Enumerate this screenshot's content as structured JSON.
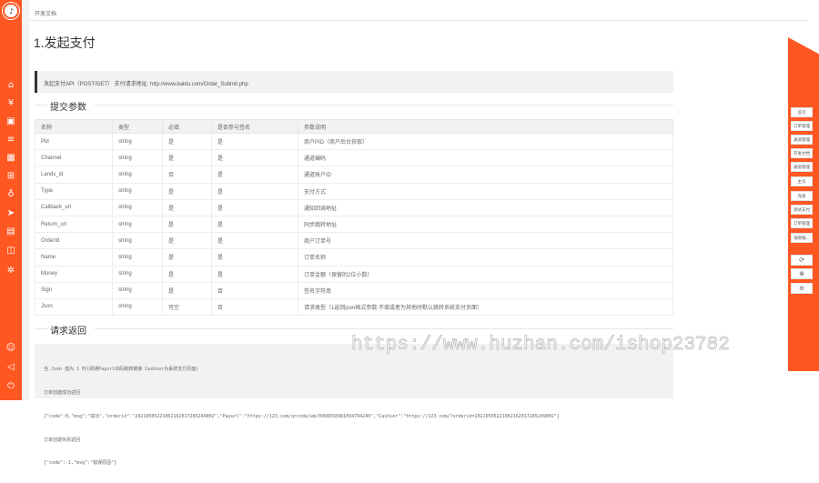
{
  "breadcrumb": "开发文档",
  "page_title": "1.发起支付",
  "api_info": "发起支付API（POST/GET）    支付请求地址:   http://www.baidu.com/Order_Submit.php",
  "section_params": "提交参数",
  "section_return": "请求返回",
  "table": {
    "headers": [
      "名称",
      "类型",
      "必填",
      "是否参与签名",
      "参数说明"
    ],
    "rows": [
      [
        "Pid",
        "string",
        "是",
        "是",
        "商户PID（商户后台获取）"
      ],
      [
        "Channel",
        "string",
        "是",
        "是",
        "通道编码"
      ],
      [
        "Lands_id",
        "string",
        "否",
        "是",
        "通道账户ID"
      ],
      [
        "Type",
        "string",
        "是",
        "是",
        "支付方式"
      ],
      [
        "Callback_url",
        "string",
        "是",
        "是",
        "通知回调地址"
      ],
      [
        "Return_url",
        "string",
        "是",
        "是",
        "同步跳转地址"
      ],
      [
        "OrderId",
        "string",
        "是",
        "是",
        "商户订单号"
      ],
      [
        "Name",
        "string",
        "是",
        "是",
        "订单名称"
      ],
      [
        "Money",
        "string",
        "是",
        "是",
        "订单金额（保留的2位小数）"
      ],
      [
        "Sign",
        "string",
        "是",
        "否",
        "签名字符串"
      ],
      [
        "Json",
        "string",
        "可空",
        "否",
        "请求类型（1返回json格式参数 不填或者为其他时默认跳转系统支付页面）"
      ]
    ]
  },
  "code_lines": [
    "当 Json 值为 1 时(即通Payurl出码跳转链接 Cashier为系统支付页面)",
    "订单创建成功返回",
    "{\"code\":0,\"msg\":\"成功\",\"orderid\":\"20210505221062162017285249002\",\"Payurl\":\"https://123.com/qrcode/wm/0968558981094794240\",\"Cashier\":\"https://123.com/?orderid=20210505221062162017285249002\"}",
    "订单创建失败返回",
    "{\"code\":-1,\"msg\":\"错误原因\"}"
  ],
  "right_menu": [
    "首页",
    "订单管理",
    "通道管理",
    "开发文档",
    "通道管理",
    "主页",
    "充值",
    "测试支付",
    "订单管理",
    "收款账..."
  ],
  "right_icons": [
    "refresh-icon",
    "close-circle-icon",
    "minus-circle-icon"
  ],
  "left_nav_icons": [
    "home-icon",
    "money-icon",
    "wallet-icon",
    "list-icon",
    "apps-icon",
    "cart-icon",
    "gift-icon",
    "send-icon",
    "calendar-icon",
    "layers-icon",
    "settings-icon",
    "user-icon",
    "volume-icon",
    "power-icon"
  ],
  "watermark": "https://www.huzhan.com/ishop23782",
  "colors": {
    "accent": "#ff5722",
    "sidebar_text": "#ffffff"
  }
}
